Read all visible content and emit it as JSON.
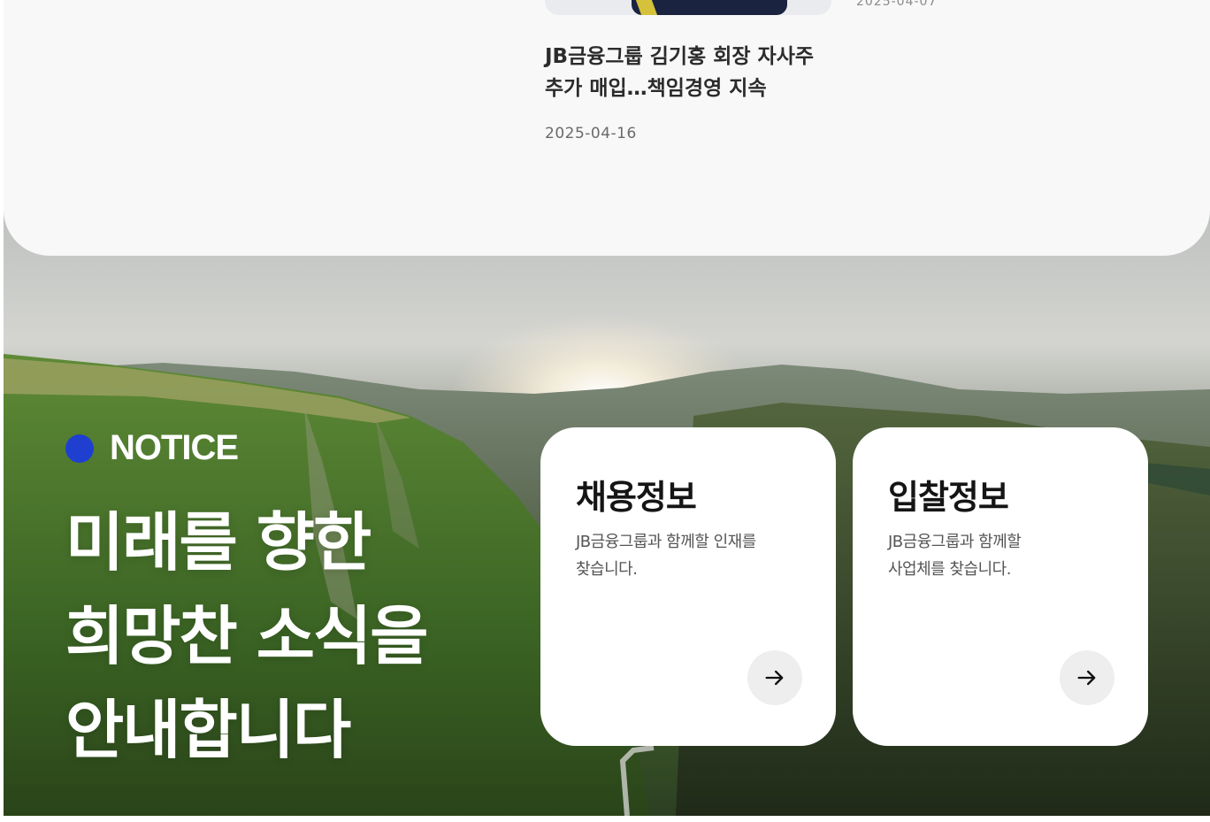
{
  "news": {
    "previous_date_partial": "2025-04-07",
    "title": "JB금융그룹 김기홍 회장 자사주\n추가 매입…책임경영 지속",
    "date": "2025-04-16"
  },
  "notice": {
    "label": "NOTICE",
    "accent_color": "#1e3fd0",
    "headline": "미래를 향한\n희망찬 소식을\n안내합니다"
  },
  "cards": {
    "recruit": {
      "title": "채용정보",
      "description": "JB금융그룹과 함께할 인재를\n찾습니다.",
      "arrow_icon": "arrow-right-icon"
    },
    "bid": {
      "title": "입찰정보",
      "description": "JB금융그룹과 함께할\n사업체를 찾습니다.",
      "arrow_icon": "arrow-right-icon"
    }
  }
}
